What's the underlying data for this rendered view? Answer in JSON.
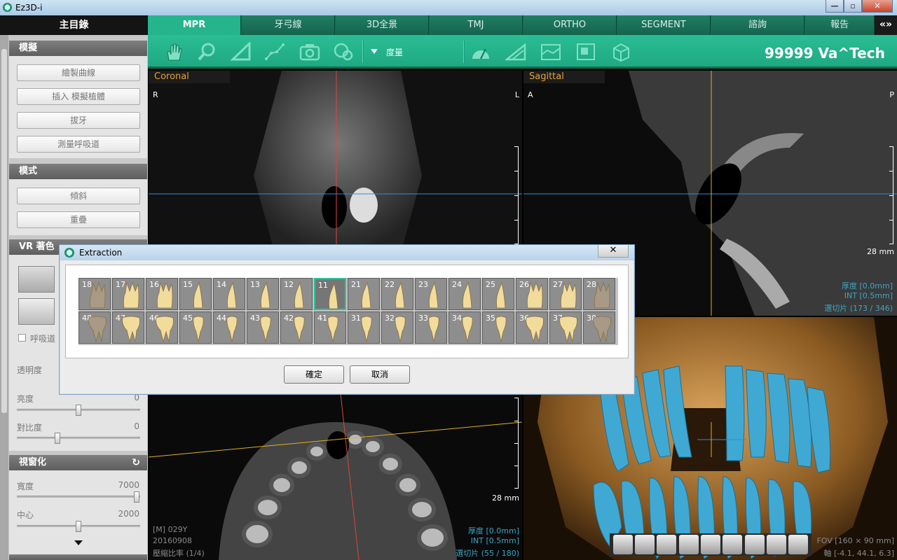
{
  "window": {
    "title": "Ez3D-i",
    "min": "—",
    "max": "▫",
    "close": "✕"
  },
  "left": {
    "main_menu": "主目錄",
    "sec_sim": "模擬",
    "btn_curve": "繪製曲線",
    "btn_implant": "插入 模擬植體",
    "btn_extract": "拔牙",
    "btn_airway": "測量呼吸道",
    "sec_mode": "模式",
    "btn_tilt": "傾斜",
    "btn_overlap": "重疊",
    "sec_vr": "VR 著色",
    "chk_airway": "呼吸道",
    "lbl_opacity": "透明度",
    "lbl_bright": "亮度",
    "val_bright": "0",
    "lbl_contrast": "對比度",
    "val_contrast": "0",
    "sec_window": "視窗化",
    "lbl_width": "寬度",
    "val_width": "7000",
    "lbl_center": "中心",
    "val_center": "2000",
    "bright_pct": 50,
    "contrast_pct": 33,
    "width_pct": 97,
    "center_pct": 50
  },
  "tabs": [
    "MPR",
    "牙弓線",
    "3D全景",
    "TMJ",
    "ORTHO",
    "SEGMENT",
    "諮詢",
    "報告"
  ],
  "tab_nav": "«»",
  "toolbar": {
    "measure_label": "度量",
    "patient": "99999 Va^Tech"
  },
  "coronal": {
    "title": "Coronal",
    "left_tag": "R",
    "right_tag": "L"
  },
  "sagittal": {
    "title": "Sagittal",
    "left_tag": "A",
    "right_tag": "P",
    "scale": "28 mm",
    "thick": "厚度 [0.0mm]",
    "int": "INT [0.5mm]",
    "slice": "選切片 (173 / 346)"
  },
  "axial": {
    "scale": "28 mm",
    "patient_info": "[M] 029Y",
    "date": "20160908",
    "zoom": "壓縮比率 (1/4)",
    "thick": "厚度 [0.0mm]",
    "int": "INT [0.5mm]",
    "slice": "選切片 (55 / 180)"
  },
  "vr": {
    "fov": "FOV [160 × 90 mm]",
    "axis": "軸 [-4.1, 44.1, 6.3]"
  },
  "dialog": {
    "title": "Extraction",
    "close": "✕",
    "ok": "確定",
    "cancel": "取消",
    "upper": [
      "18",
      "17",
      "16",
      "15",
      "14",
      "13",
      "12",
      "11",
      "21",
      "22",
      "23",
      "24",
      "25",
      "26",
      "27",
      "28"
    ],
    "lower": [
      "48",
      "47",
      "46",
      "45",
      "44",
      "43",
      "42",
      "41",
      "31",
      "32",
      "33",
      "34",
      "35",
      "36",
      "37",
      "38"
    ],
    "selected": "11"
  },
  "colors": {
    "accent": "#25b48b",
    "tab_dark": "#14644c",
    "orange_text": "#e6a23c",
    "cyan_text": "#3aa6c7"
  }
}
